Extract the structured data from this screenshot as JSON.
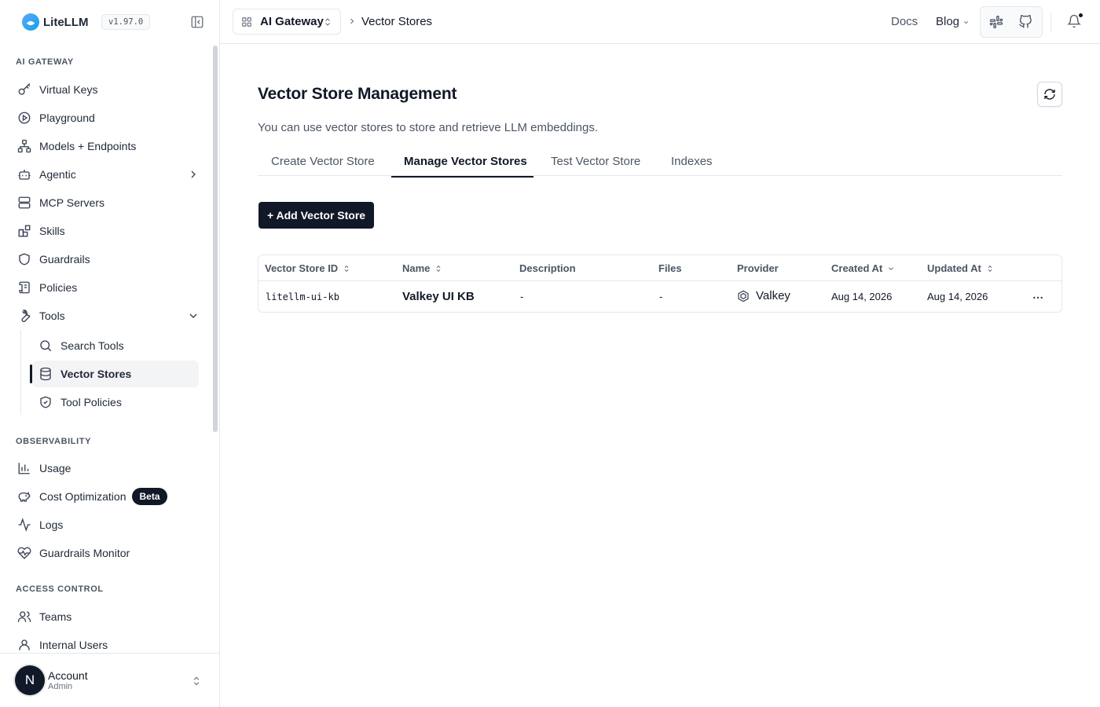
{
  "app": {
    "name": "LiteLLM",
    "version": "v1.97.0"
  },
  "sidebar": {
    "sections": [
      {
        "label": "AI GATEWAY"
      },
      {
        "label": "OBSERVABILITY"
      },
      {
        "label": "ACCESS CONTROL"
      }
    ],
    "gateway_items": [
      {
        "label": "Virtual Keys",
        "icon": "key-icon"
      },
      {
        "label": "Playground",
        "icon": "play-circle-icon"
      },
      {
        "label": "Models + Endpoints",
        "icon": "network-icon"
      },
      {
        "label": "Agentic",
        "icon": "bot-icon"
      },
      {
        "label": "MCP Servers",
        "icon": "server-icon"
      },
      {
        "label": "Skills",
        "icon": "blocks-icon"
      },
      {
        "label": "Guardrails",
        "icon": "shield-icon"
      },
      {
        "label": "Policies",
        "icon": "scroll-icon"
      },
      {
        "label": "Tools",
        "icon": "wrench-icon"
      }
    ],
    "tools_subitems": [
      {
        "label": "Search Tools",
        "icon": "search-icon"
      },
      {
        "label": "Vector Stores",
        "icon": "database-icon",
        "active": true
      },
      {
        "label": "Tool Policies",
        "icon": "shield-check-icon"
      }
    ],
    "observability_items": [
      {
        "label": "Usage",
        "icon": "bar-chart-icon"
      },
      {
        "label": "Cost Optimization",
        "icon": "piggy-bank-icon",
        "badge": "Beta"
      },
      {
        "label": "Logs",
        "icon": "activity-icon"
      },
      {
        "label": "Guardrails Monitor",
        "icon": "heart-pulse-icon"
      }
    ],
    "access_items": [
      {
        "label": "Teams",
        "icon": "users-icon"
      },
      {
        "label": "Internal Users",
        "icon": "user-icon"
      }
    ],
    "account": {
      "initial": "N",
      "name": "Account",
      "role": "Admin"
    }
  },
  "topbar": {
    "workspace": "AI Gateway",
    "breadcrumb": "Vector Stores",
    "docs": "Docs",
    "blog": "Blog"
  },
  "main": {
    "title": "Vector Store Management",
    "subtitle": "You can use vector stores to store and retrieve LLM embeddings.",
    "tabs": [
      {
        "label": "Create Vector Store"
      },
      {
        "label": "Manage Vector Stores",
        "active": true
      },
      {
        "label": "Test Vector Store"
      },
      {
        "label": "Indexes"
      }
    ],
    "add_button": "+ Add Vector Store",
    "table": {
      "columns": [
        "Vector Store ID",
        "Name",
        "Description",
        "Files",
        "Provider",
        "Created At",
        "Updated At"
      ],
      "rows": [
        {
          "id": "litellm-ui-kb",
          "name": "Valkey UI KB",
          "description": "-",
          "files": "-",
          "provider": "Valkey",
          "created_at": "Aug 14, 2026",
          "updated_at": "Aug 14, 2026"
        }
      ]
    }
  }
}
